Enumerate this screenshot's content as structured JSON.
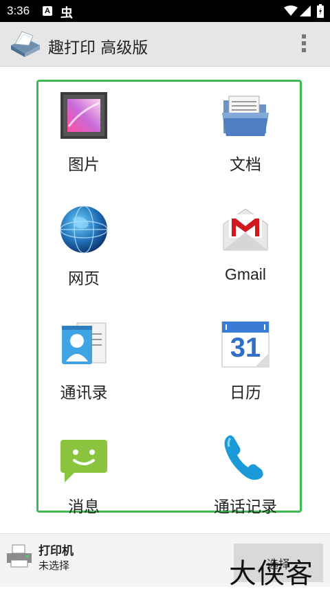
{
  "status_bar": {
    "time": "3:36",
    "notification_a": "A",
    "notification_bug": "虫"
  },
  "app_bar": {
    "title": "趣打印 高级版"
  },
  "grid": {
    "items": [
      {
        "label": "图片",
        "icon": "gallery-icon"
      },
      {
        "label": "文档",
        "icon": "document-folder-icon"
      },
      {
        "label": "网页",
        "icon": "globe-icon"
      },
      {
        "label": "Gmail",
        "icon": "gmail-icon"
      },
      {
        "label": "通讯录",
        "icon": "contacts-icon"
      },
      {
        "label": "日历",
        "icon": "calendar-icon"
      },
      {
        "label": "消息",
        "icon": "messages-icon"
      },
      {
        "label": "通话记录",
        "icon": "call-log-icon"
      }
    ],
    "calendar_day": "31",
    "frame_color": "#3cbc4f"
  },
  "printer_panel": {
    "title": "打印机",
    "status": "未选择",
    "select_label": "选择"
  },
  "watermark": "大侠客"
}
